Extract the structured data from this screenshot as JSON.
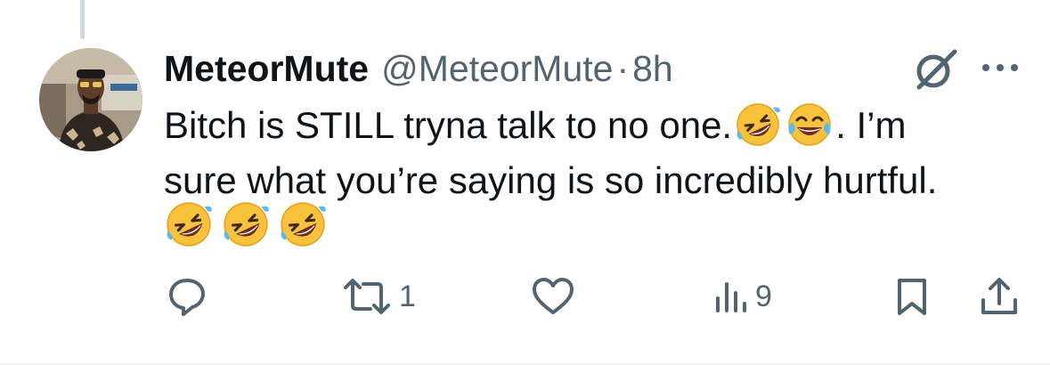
{
  "tweet": {
    "display_name": "MeteorMute",
    "handle": "@MeteorMute",
    "separator": "·",
    "time": "8h",
    "text_line_1": "Bitch is STILL tryna talk to no one.",
    "text_after_emojis": ". I’m",
    "text_line_2": "sure what you’re saying is so incredibly hurtful.",
    "inline_emojis": [
      "rolling-on-floor-laughing",
      "face-with-tears-of-joy"
    ],
    "trailing_emojis": [
      "rolling-on-floor-laughing",
      "rolling-on-floor-laughing",
      "rolling-on-floor-laughing"
    ]
  },
  "actions": {
    "reply_count": "",
    "retweet_count": "1",
    "like_count": "",
    "views_count": "9"
  },
  "icons": {
    "grok": "grok-icon",
    "more": "more-dots-icon",
    "reply": "reply-icon",
    "retweet": "retweet-icon",
    "like": "heart-icon",
    "views": "views-bar-icon",
    "bookmark": "bookmark-icon",
    "share": "share-icon"
  },
  "colors": {
    "text": "#0f1419",
    "secondary": "#536471",
    "divider": "#eff3f4",
    "thread_line": "#cfd9de"
  }
}
